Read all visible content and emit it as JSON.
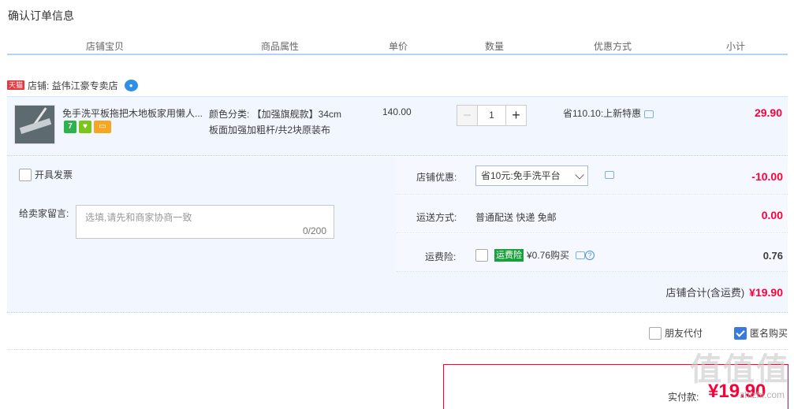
{
  "page": {
    "title": "确认订单信息"
  },
  "columns": {
    "shop_item": "店铺宝贝",
    "attributes": "商品属性",
    "unit_price": "单价",
    "quantity": "数量",
    "discount": "优惠方式",
    "subtotal": "小计"
  },
  "shop": {
    "badge": "天猫",
    "label": "店铺: 益伟江豪专卖店"
  },
  "item": {
    "title": "免手洗平板拖把木地板家用懒人...",
    "attr_line1": "颜色分类: 【加强旗舰款】34cm",
    "attr_line2": "板面加强加粗杆/共2块原装布",
    "price": "140.00",
    "qty": "1",
    "promo": "省110.10:上新特惠",
    "subtotal": "29.90",
    "badge_seven": "7"
  },
  "left": {
    "invoice_label": "开具发票",
    "message_label": "给卖家留言:",
    "message_placeholder": "选填,请先和商家协商一致",
    "message_count": "0/200"
  },
  "right": {
    "shop_discount_label": "店铺优惠:",
    "shop_discount_option": "省10元:免手洗平台",
    "shop_discount_value": "-10.00",
    "shipping_label": "运送方式:",
    "shipping_text": "普通配送 快递 免邮",
    "shipping_value": "0.00",
    "insurance_label": "运费险:",
    "insurance_tag": "运费险",
    "insurance_text": "¥0.76购买",
    "insurance_value": "0.76",
    "total_label": "店铺合计(含运费)",
    "total_value": "¥19.90"
  },
  "options": {
    "friend_pay": "朋友代付",
    "anonymous": "匿名购买"
  },
  "pay": {
    "label": "实付款:",
    "amount": "¥19.90"
  },
  "watermark": {
    "text": "值值值",
    "sub": "zhizhi.com"
  },
  "colors": {
    "accent": "#ff0036",
    "row_bg": "#f2f7ff",
    "header_line": "#b2d1ff"
  }
}
